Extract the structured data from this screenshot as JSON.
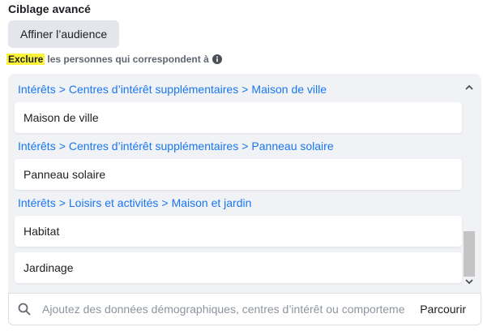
{
  "section": {
    "title": "Ciblage avancé"
  },
  "refine_button": {
    "label": "Affiner l’audience"
  },
  "exclude": {
    "highlight": "Exclure",
    "rest": "les personnes qui correspondent à"
  },
  "groups": [
    {
      "path": [
        "Intérêts",
        "Centres d’intérêt supplémentaires",
        "Maison de ville"
      ],
      "items": [
        "Maison de ville"
      ]
    },
    {
      "path": [
        "Intérêts",
        "Centres d’intérêt supplémentaires",
        "Panneau solaire"
      ],
      "items": [
        "Panneau solaire"
      ]
    },
    {
      "path": [
        "Intérêts",
        "Loisirs et activités",
        "Maison et jardin"
      ],
      "items": [
        "Habitat",
        "Jardinage"
      ]
    }
  ],
  "search": {
    "placeholder": "Ajoutez des données démographiques, centres d’intérêt ou comportements",
    "browse_label": "Parcourir"
  },
  "colors": {
    "link": "#1877f2",
    "highlight": "#fbf33b",
    "panel_bg": "#f0f2f5",
    "button_bg": "#e4e6eb"
  },
  "icons": {
    "info": "info-icon",
    "search": "search-icon",
    "scroll_up": "chevron-up-icon",
    "scroll_down": "chevron-down-icon"
  }
}
